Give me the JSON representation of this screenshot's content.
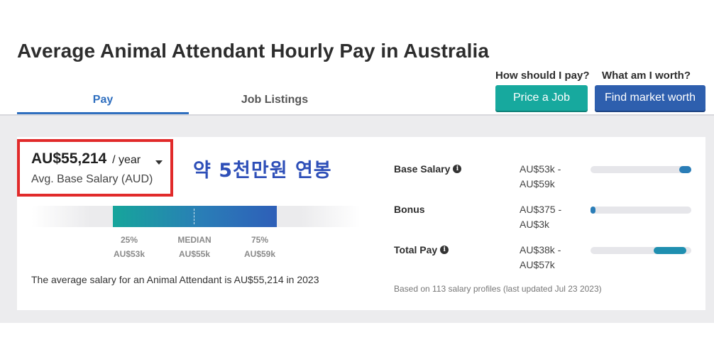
{
  "page": {
    "title": "Average Animal Attendant Hourly Pay in Australia"
  },
  "tabs": [
    {
      "label": "Pay"
    },
    {
      "label": "Job Listings"
    }
  ],
  "cta": {
    "price_question": "How should I pay?",
    "price_button": "Price a Job",
    "worth_question": "What am I worth?",
    "worth_button": "Find market worth"
  },
  "salary": {
    "amount": "AU$55,214",
    "period": "/ year",
    "label": "Avg. Base Salary (AUD)",
    "annotation": "약 5천만원 연봉"
  },
  "distribution": {
    "p25_label": "25%",
    "p25_value": "AU$53k",
    "median_label": "MEDIAN",
    "median_value": "AU$55k",
    "p75_label": "75%",
    "p75_value": "AU$59k"
  },
  "summary": "The average salary for an Animal Attendant is AU$55,214 in 2023",
  "compensation": [
    {
      "label": "Base Salary",
      "range_low": "AU$53k -",
      "range_high": "AU$59k",
      "has_info": true,
      "fill_start": 0.88,
      "fill_end": 1.0,
      "color": "#2a7db7"
    },
    {
      "label": "Bonus",
      "range_low": "AU$375 -",
      "range_high": "AU$3k",
      "has_info": false,
      "fill_start": 0.0,
      "fill_end": 0.05,
      "color": "#2a7db7"
    },
    {
      "label": "Total Pay",
      "range_low": "AU$38k -",
      "range_high": "AU$57k",
      "has_info": true,
      "fill_start": 0.63,
      "fill_end": 0.95,
      "color": "#1f8fb0"
    }
  ],
  "footnote": "Based on 113 salary profiles (last updated Jul 23 2023)",
  "colors": {
    "accent_blue": "#2f6fbf",
    "teal_button": "#17a99e",
    "blue_button": "#2e5fae",
    "highlight_box": "#e12a2a",
    "annotation_text": "#2e4fb8"
  }
}
